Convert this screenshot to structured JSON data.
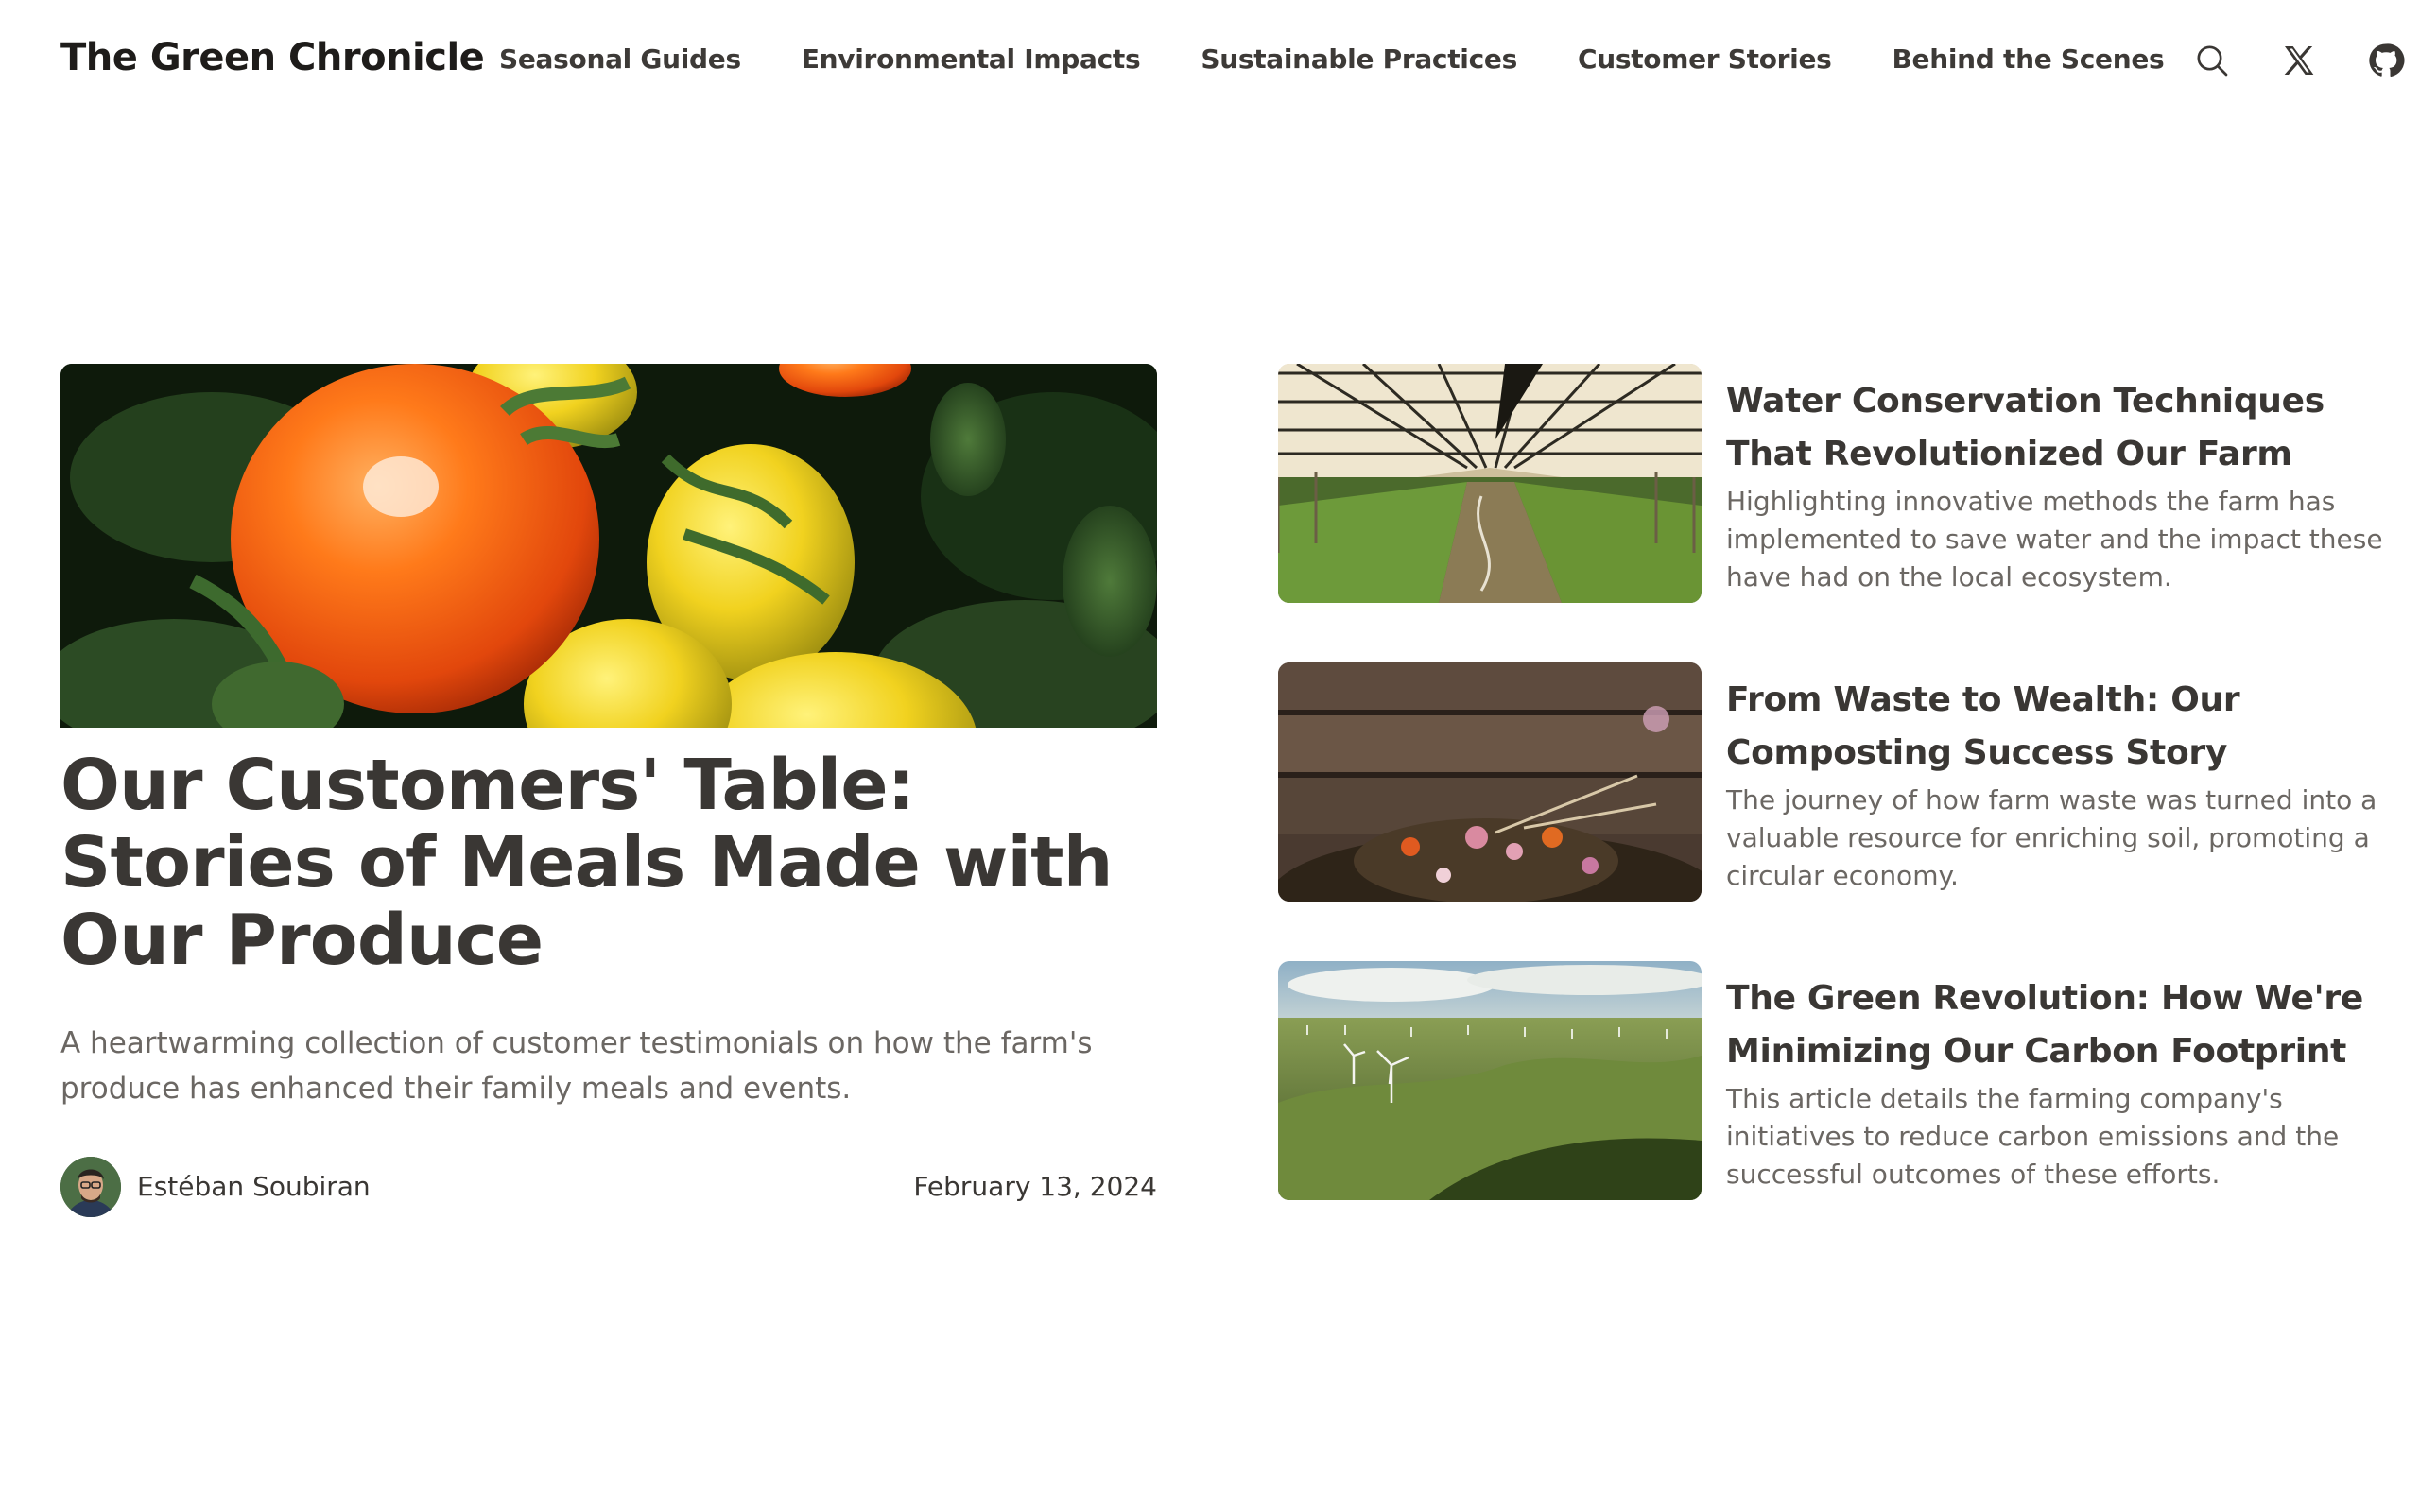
{
  "brand": "The Green Chronicle",
  "nav": [
    {
      "label": "Seasonal Guides"
    },
    {
      "label": "Environmental Impacts"
    },
    {
      "label": "Sustainable Practices"
    },
    {
      "label": "Customer Stories"
    },
    {
      "label": "Behind the Scenes"
    }
  ],
  "header_icons": [
    "search-icon",
    "x-icon",
    "github-icon"
  ],
  "featured": {
    "title": "Our Customers' Table: Stories of Meals Made with Our Produce",
    "description": "A heartwarming collection of customer testimonials on how the farm's produce has enhanced their family meals and events.",
    "author": "Estéban Soubiran",
    "date": "February 13, 2024"
  },
  "side_articles": [
    {
      "title": "Water Conservation Techniques That Revolutionized Our Farm",
      "description": "Highlighting innovative methods the farm has implemented to save water and the impact these have had on the local ecosystem."
    },
    {
      "title": "From Waste to Wealth: Our Composting Success Story",
      "description": "The journey of how farm waste was turned into a valuable resource for enriching soil, promoting a circular economy."
    },
    {
      "title": "The Green Revolution: How We're Minimizing Our Carbon Footprint",
      "description": "This article details the farming company's initiatives to reduce carbon emissions and the successful outcomes of these efforts."
    }
  ]
}
